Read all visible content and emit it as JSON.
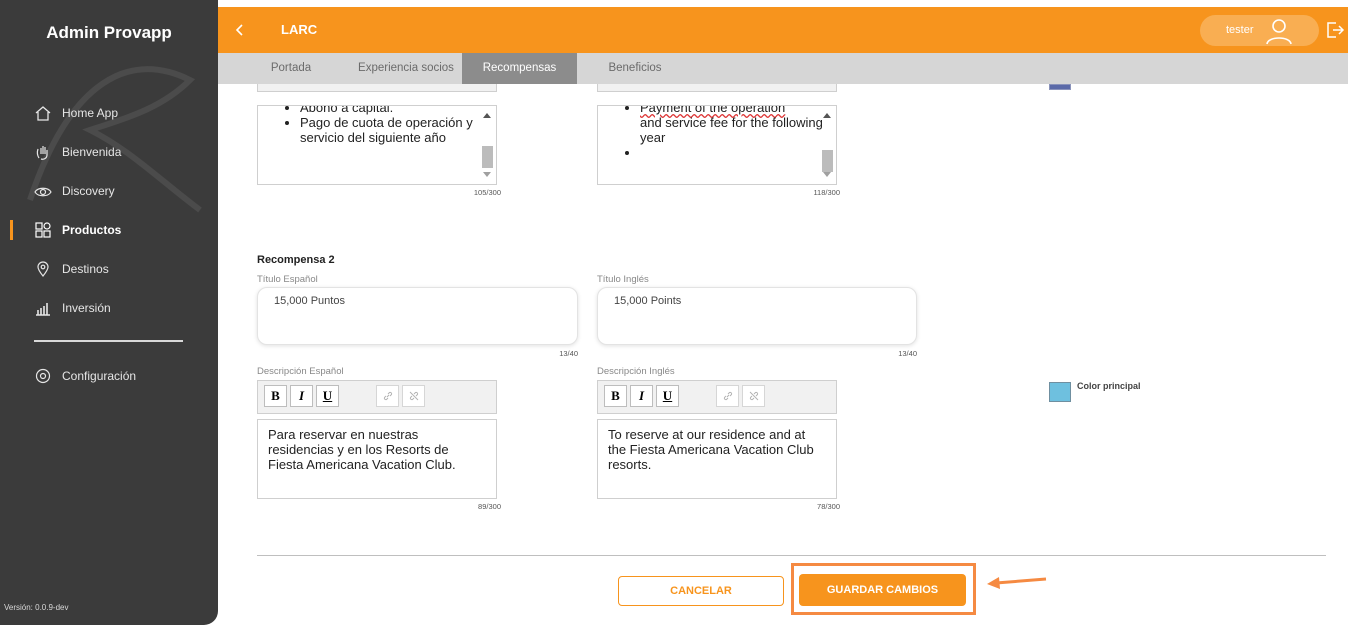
{
  "sidebar": {
    "brand": "Admin Provapp",
    "items": [
      {
        "label": "Home App",
        "icon": "home-icon"
      },
      {
        "label": "Bienvenida",
        "icon": "wave-hand-icon"
      },
      {
        "label": "Discovery",
        "icon": "eye-icon"
      },
      {
        "label": "Productos",
        "icon": "grid-icon",
        "active": true
      },
      {
        "label": "Destinos",
        "icon": "location-pin-icon"
      },
      {
        "label": "Inversión",
        "icon": "bar-chart-icon"
      }
    ],
    "settings_label": "Configuración",
    "version": "Versión: 0.0.9-dev"
  },
  "header": {
    "title": "LARC",
    "user": "tester"
  },
  "tabs": [
    {
      "label": "Portada"
    },
    {
      "label": "Experiencia socios"
    },
    {
      "label": "Recompensas",
      "active": true
    },
    {
      "label": "Beneficios"
    }
  ],
  "reward1": {
    "es_bullets": [
      "Abono a capital.",
      "Pago de cuota de operación y servicio del siguiente año"
    ],
    "es_count": "105/300",
    "en_bullets": [
      "Payment of the operation",
      "and service fee for the following year",
      ""
    ],
    "en_count": "118/300"
  },
  "reward2": {
    "heading": "Recompensa 2",
    "title_es_label": "Título Español",
    "title_es": "15,000 Puntos",
    "title_es_count": "13/40",
    "title_en_label": "Título Inglés",
    "title_en": "15,000 Points",
    "title_en_count": "13/40",
    "desc_es_label": "Descripción Español",
    "desc_es": "Para reservar en nuestras residencias y en los Resorts de Fiesta Americana Vacation Club.",
    "desc_es_count": "89/300",
    "desc_en_label": "Descripción Inglés",
    "desc_en": "To reserve at our residence and at the Fiesta Americana Vacation Club resorts.",
    "desc_en_count": "78/300",
    "color_label": "Color principal"
  },
  "toolbar": {
    "bold": "B",
    "italic": "I",
    "underline": "U"
  },
  "actions": {
    "cancel": "CANCELAR",
    "save": "GUARDAR CAMBIOS"
  },
  "colors": {
    "accent": "#f7941d",
    "sidebar": "#3b3b3b",
    "swatch_top": "#5b6aa8",
    "swatch_main": "#6ec0df"
  }
}
